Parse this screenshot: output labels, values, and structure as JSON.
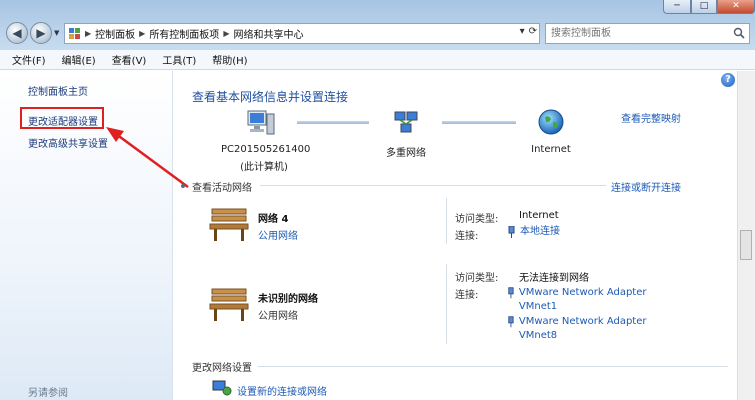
{
  "window": {
    "minimize": "─",
    "maximize": "□",
    "close": "✕"
  },
  "nav": {
    "back": "◀",
    "forward": "▶"
  },
  "address": {
    "crumbs": [
      "控制面板",
      "所有控制面板项",
      "网络和共享中心"
    ],
    "search_placeholder": "搜索控制面板"
  },
  "menu": [
    "文件(F)",
    "编辑(E)",
    "查看(V)",
    "工具(T)",
    "帮助(H)"
  ],
  "sidebar": {
    "home": "控制面板主页",
    "adapter": "更改适配器设置",
    "advanced": "更改高级共享设置",
    "see_also": "另请参阅"
  },
  "main": {
    "title": "查看基本网络信息并设置连接",
    "view_full_map": "查看完整映射",
    "nodes": [
      {
        "line1": "PC201505261400",
        "line2": "(此计算机)"
      },
      {
        "line1": "多重网络"
      },
      {
        "line1": "Internet"
      }
    ],
    "active_section": {
      "title": "查看活动网络",
      "link": "连接或断开连接"
    },
    "networks": [
      {
        "name": "网络  4",
        "type": "公用网络",
        "access_key": "访问类型:",
        "access_val": "Internet",
        "conn_key": "连接:",
        "connections": [
          "本地连接"
        ]
      },
      {
        "name": "未识别的网络",
        "type": "公用网络",
        "access_key": "访问类型:",
        "access_val": "无法连接到网络",
        "conn_key": "连接:",
        "connections": [
          "VMware Network Adapter VMnet1",
          "VMware Network Adapter VMnet8"
        ]
      }
    ],
    "settings_section": {
      "title": "更改网络设置",
      "new_connection": "设置新的连接或网络"
    }
  },
  "help": "?",
  "colors": {
    "link": "#1c5ab4",
    "title": "#1f4fa0",
    "highlight": "#e02020"
  }
}
